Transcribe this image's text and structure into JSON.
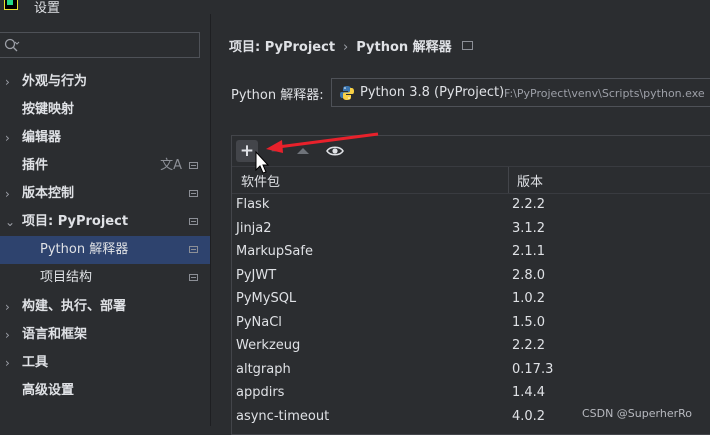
{
  "window": {
    "title": "设置"
  },
  "search": {
    "placeholder": ""
  },
  "sidebar": {
    "items": [
      {
        "label": "外观与行为",
        "chevron": "›"
      },
      {
        "label": "按键映射"
      },
      {
        "label": "编辑器",
        "chevron": "›"
      },
      {
        "label": "插件",
        "lang_icon": "文A"
      },
      {
        "label": "版本控制",
        "chevron": "›"
      },
      {
        "label": "项目: PyProject",
        "chevron": "⌄"
      },
      {
        "label": "Python 解释器"
      },
      {
        "label": "项目结构"
      },
      {
        "label": "构建、执行、部署",
        "chevron": "›"
      },
      {
        "label": "语言和框架",
        "chevron": "›"
      },
      {
        "label": "工具",
        "chevron": "›"
      },
      {
        "label": "高级设置"
      }
    ]
  },
  "breadcrumb": {
    "project": "项目: PyProject",
    "separator": "›",
    "page": "Python 解释器"
  },
  "interpreter": {
    "label": "Python 解释器:",
    "name": "Python 3.8 (PyProject)",
    "path": "F:\\PyProject\\venv\\Scripts\\python.exe"
  },
  "toolbar": {
    "add": "+",
    "remove": "−",
    "upgrade": "▲",
    "show_early": "◉"
  },
  "table": {
    "headers": {
      "package": "软件包",
      "version": "版本"
    },
    "rows": [
      {
        "name": "Flask",
        "version": "2.2.2"
      },
      {
        "name": "Jinja2",
        "version": "3.1.2"
      },
      {
        "name": "MarkupSafe",
        "version": "2.1.1"
      },
      {
        "name": "PyJWT",
        "version": "2.8.0"
      },
      {
        "name": "PyMySQL",
        "version": "1.0.2"
      },
      {
        "name": "PyNaCl",
        "version": "1.5.0"
      },
      {
        "name": "Werkzeug",
        "version": "2.2.2"
      },
      {
        "name": "altgraph",
        "version": "0.17.3"
      },
      {
        "name": "appdirs",
        "version": "1.4.4"
      },
      {
        "name": "async-timeout",
        "version": "4.0.2"
      }
    ]
  },
  "watermark": "CSDN @SuperherRo",
  "colors": {
    "selected": "#2e436e",
    "annotation_arrow": "#e8212b",
    "python_blue": "#3a75b0",
    "python_yellow": "#f7d046"
  }
}
